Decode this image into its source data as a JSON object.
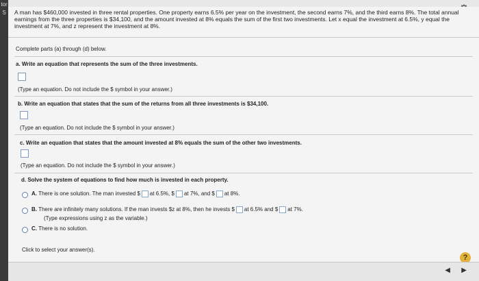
{
  "left_strip": {
    "line1": "tor",
    "line2": "S"
  },
  "problem": {
    "text": "A man has $460,000 invested in three rental properties. One property earns 6.5% per year on the investment, the second earns 7%, and the third earns 8%. The total annual earnings from the three properties is $34,100, and the amount invested at 8% equals the sum of the first two investments. Let x equal the investment at 6.5%, y equal the investment at 7%, and z represent the investment at 8%."
  },
  "instructions": "Complete parts (a) through (d) below.",
  "part_a": {
    "question": "a. Write an equation that represents the sum of the three investments.",
    "hint": "(Type an equation. Do not include the $ symbol in your answer.)"
  },
  "part_b": {
    "question": "b. Write an equation that states that the sum of the returns from all three investments is $34,100.",
    "hint": "(Type an equation. Do not include the $ symbol in your answer.)"
  },
  "part_c": {
    "question": "c. Write an equation that states that the amount invested at 8% equals the sum of the other two investments.",
    "hint": "(Type an equation. Do not include the $ symbol in your answer.)"
  },
  "part_d": {
    "question": "d. Solve the system of equations to find how much is invested in each property.",
    "option_a": {
      "letter": "A.",
      "text1": "There is one solution. The man invested $",
      "text2": "at 6.5%, $",
      "text3": "at 7%, and $",
      "text4": "at 8%."
    },
    "option_b": {
      "letter": "B.",
      "text1": "There are infinitely many solutions. If the man invests $z at 8%, then he invests $",
      "text2": "at 6.5% and $",
      "text3": "at 7%.",
      "subtext": "(Type expressions using z as the variable.)"
    },
    "option_c": {
      "letter": "C.",
      "text": "There is no solution."
    }
  },
  "footer_prompt": "Click to select your answer(s).",
  "icons": {
    "gear": "gear-icon",
    "help": "help-icon",
    "prev": "prev-arrow-icon",
    "next": "next-arrow-icon"
  }
}
